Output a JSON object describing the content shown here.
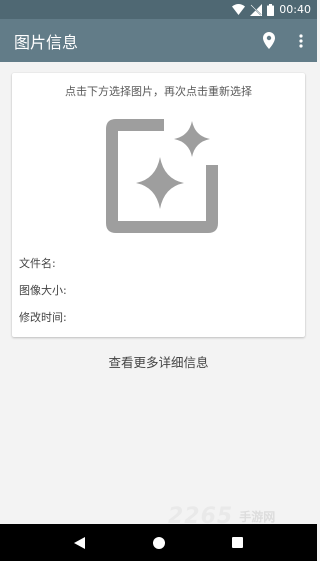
{
  "status_bar": {
    "time": "00:40",
    "icons": [
      "wifi-icon",
      "signal-no-sim-icon",
      "battery-icon"
    ]
  },
  "app_bar": {
    "title": "图片信息",
    "actions": [
      "location-pin-icon",
      "more-vert-icon"
    ]
  },
  "card": {
    "hint": "点击下方选择图片，再次点击重新选择",
    "placeholder_icon": "add-photo-sparkle-icon",
    "fields": [
      {
        "label": "文件名:",
        "value": ""
      },
      {
        "label": "图像大小:",
        "value": ""
      },
      {
        "label": "修改时间:",
        "value": ""
      }
    ]
  },
  "more_link": "查看更多详细信息",
  "watermark": {
    "digits": "2265",
    "text": "手游网"
  },
  "nav_bar": {
    "buttons": [
      "back-icon",
      "home-icon",
      "recents-icon"
    ]
  },
  "colors": {
    "status_bar": "#4f6873",
    "app_bar": "#627c88",
    "icon_gray": "#9e9e9e"
  }
}
